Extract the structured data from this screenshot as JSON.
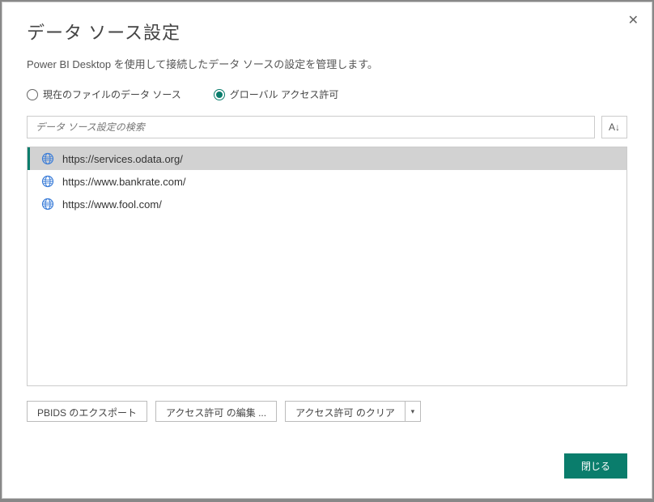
{
  "dialog": {
    "title": "データ ソース設定",
    "subtitle": "Power BI Desktop を使用して接続したデータ ソースの設定を管理します。"
  },
  "radio": {
    "current": "現在のファイルのデータ ソース",
    "global": "グローバル アクセス許可"
  },
  "search": {
    "placeholder": "データ ソース設定の検索"
  },
  "sources": {
    "item0": "https://services.odata.org/",
    "item1": "https://www.bankrate.com/",
    "item2": "https://www.fool.com/"
  },
  "buttons": {
    "export": "PBIDS のエクスポート",
    "edit": "アクセス許可 の編集 ...",
    "clear": "アクセス許可 のクリア",
    "close": "閉じる"
  }
}
